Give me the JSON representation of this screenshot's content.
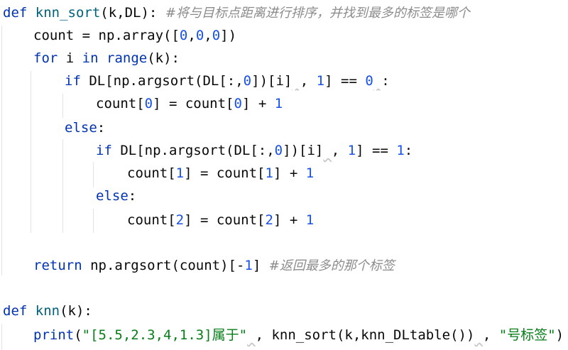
{
  "editor": {
    "lines": [
      {
        "indent": 0,
        "tokens": [
          {
            "t": "def",
            "c": "kw"
          },
          {
            "t": " "
          },
          {
            "t": "knn_sort",
            "c": "fn"
          },
          {
            "t": "(k,DL): "
          },
          {
            "t": "#将与目标点距离进行排序，并找到最多的标签是哪个",
            "c": "cmt"
          }
        ]
      },
      {
        "indent": 1,
        "tokens": [
          {
            "t": "count = np.array(["
          },
          {
            "t": "0",
            "c": "num"
          },
          {
            "t": ","
          },
          {
            "t": "0",
            "c": "num"
          },
          {
            "t": ","
          },
          {
            "t": "0",
            "c": "num"
          },
          {
            "t": "])"
          }
        ]
      },
      {
        "indent": 1,
        "tokens": [
          {
            "t": "for",
            "c": "kw"
          },
          {
            "t": " i "
          },
          {
            "t": "in",
            "c": "kw"
          },
          {
            "t": " "
          },
          {
            "t": "range",
            "c": "kw"
          },
          {
            "t": "(k):"
          }
        ]
      },
      {
        "indent": 2,
        "tokens": [
          {
            "t": "if",
            "c": "kw"
          },
          {
            "t": " DL[np.argsort(DL[:,"
          },
          {
            "t": "0",
            "c": "num"
          },
          {
            "t": "])[i]"
          },
          {
            "t": " ",
            "c": "squig"
          },
          {
            "t": ", "
          },
          {
            "t": "1",
            "c": "num"
          },
          {
            "t": "] == "
          },
          {
            "t": "0",
            "c": "num"
          },
          {
            "t": " ",
            "c": "squig"
          },
          {
            "t": ":"
          }
        ]
      },
      {
        "indent": 3,
        "tokens": [
          {
            "t": "count["
          },
          {
            "t": "0",
            "c": "num"
          },
          {
            "t": "] = count["
          },
          {
            "t": "0",
            "c": "num"
          },
          {
            "t": "] + "
          },
          {
            "t": "1",
            "c": "num"
          }
        ]
      },
      {
        "indent": 2,
        "tokens": [
          {
            "t": "else",
            "c": "kw"
          },
          {
            "t": ":"
          }
        ]
      },
      {
        "indent": 3,
        "tokens": [
          {
            "t": "if",
            "c": "kw"
          },
          {
            "t": " DL[np.argsort(DL[:,"
          },
          {
            "t": "0",
            "c": "num"
          },
          {
            "t": "])[i]"
          },
          {
            "t": " ",
            "c": "squig"
          },
          {
            "t": ", "
          },
          {
            "t": "1",
            "c": "num"
          },
          {
            "t": "] == "
          },
          {
            "t": "1",
            "c": "num"
          },
          {
            "t": ":"
          }
        ]
      },
      {
        "indent": 4,
        "tokens": [
          {
            "t": "count["
          },
          {
            "t": "1",
            "c": "num"
          },
          {
            "t": "] = count["
          },
          {
            "t": "1",
            "c": "num"
          },
          {
            "t": "] + "
          },
          {
            "t": "1",
            "c": "num"
          }
        ]
      },
      {
        "indent": 3,
        "tokens": [
          {
            "t": "else",
            "c": "kw"
          },
          {
            "t": ":"
          }
        ]
      },
      {
        "indent": 4,
        "tokens": [
          {
            "t": "count["
          },
          {
            "t": "2",
            "c": "num"
          },
          {
            "t": "] = count["
          },
          {
            "t": "2",
            "c": "num"
          },
          {
            "t": "] + "
          },
          {
            "t": "1",
            "c": "num"
          }
        ]
      },
      {
        "indent": 0,
        "tokens": []
      },
      {
        "indent": 1,
        "tokens": [
          {
            "t": "return",
            "c": "kw"
          },
          {
            "t": " np.argsort(count)[-"
          },
          {
            "t": "1",
            "c": "num"
          },
          {
            "t": "] "
          },
          {
            "t": "#返回最多的那个标签",
            "c": "cmt"
          }
        ]
      },
      {
        "indent": 0,
        "tokens": []
      },
      {
        "indent": 0,
        "tokens": [
          {
            "t": "def",
            "c": "kw"
          },
          {
            "t": " "
          },
          {
            "t": "knn",
            "c": "fn"
          },
          {
            "t": "(k):"
          }
        ]
      },
      {
        "indent": 1,
        "tokens": [
          {
            "t": "print",
            "c": "kw"
          },
          {
            "t": "("
          },
          {
            "t": "\"[5.5,2.3,4,1.3]属于\"",
            "c": "str"
          },
          {
            "t": " ",
            "c": "squig"
          },
          {
            "t": ", knn_sort(k,knn_DLtable())"
          },
          {
            "t": " ",
            "c": "squig"
          },
          {
            "t": ", "
          },
          {
            "t": "\"号标签\"",
            "c": "str"
          },
          {
            "t": ")"
          }
        ]
      }
    ]
  }
}
